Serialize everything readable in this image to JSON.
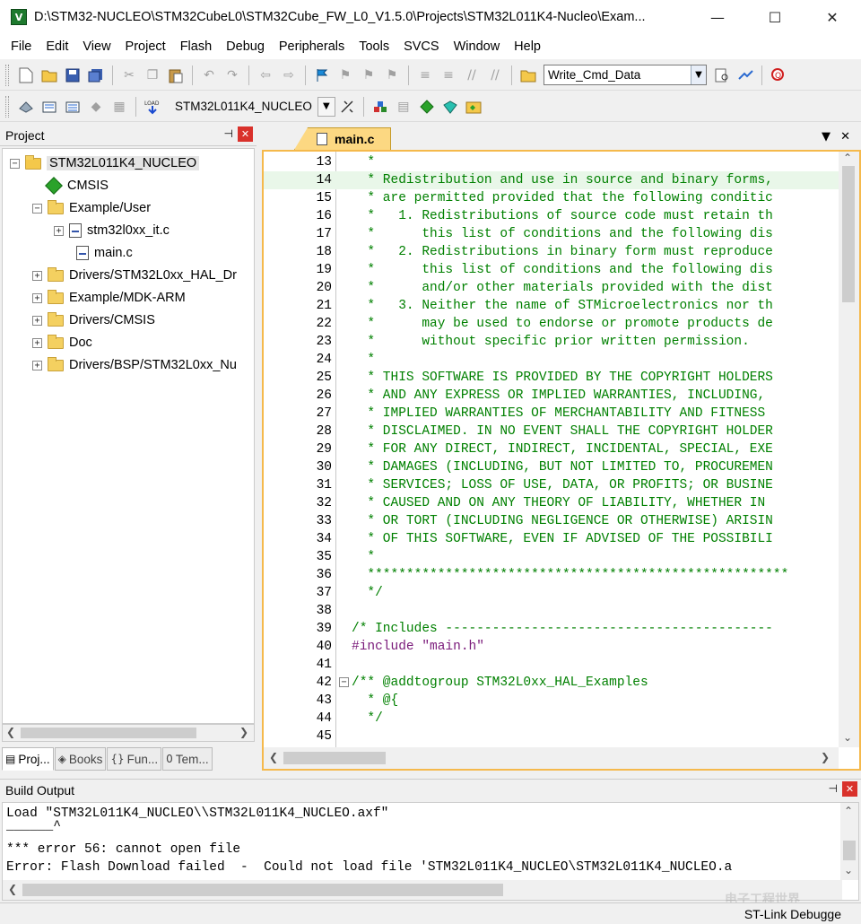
{
  "window": {
    "title": "D:\\STM32-NUCLEO\\STM32CubeL0\\STM32Cube_FW_L0_V1.5.0\\Projects\\STM32L011K4-Nucleo\\Exam...",
    "app_icon": "V",
    "minimize": "—",
    "maximize": "☐",
    "close": "✕"
  },
  "menu": [
    "File",
    "Edit",
    "View",
    "Project",
    "Flash",
    "Debug",
    "Peripherals",
    "Tools",
    "SVCS",
    "Window",
    "Help"
  ],
  "toolbar": {
    "find_combo_value": "Write_Cmd_Data",
    "target_value": "STM32L011K4_NUCLEO"
  },
  "project_panel": {
    "title": "Project",
    "pin": "⊣",
    "close": "✕",
    "tree": [
      {
        "label": "STM32L011K4_NUCLEO",
        "expander": "−",
        "type": "root"
      },
      {
        "label": "CMSIS",
        "expander": "",
        "type": "gem"
      },
      {
        "label": "Example/User",
        "expander": "−",
        "type": "folder"
      },
      {
        "label": "stm32l0xx_it.c",
        "expander": "+",
        "type": "file"
      },
      {
        "label": "main.c",
        "expander": "",
        "type": "file"
      },
      {
        "label": "Drivers/STM32L0xx_HAL_Dr",
        "expander": "+",
        "type": "folder"
      },
      {
        "label": "Example/MDK-ARM",
        "expander": "+",
        "type": "folder"
      },
      {
        "label": "Drivers/CMSIS",
        "expander": "+",
        "type": "folder"
      },
      {
        "label": "Doc",
        "expander": "+",
        "type": "folder"
      },
      {
        "label": "Drivers/BSP/STM32L0xx_Nu",
        "expander": "+",
        "type": "folder"
      }
    ],
    "tabs": [
      "Proj...",
      "Books",
      "Fun...",
      "Tem..."
    ]
  },
  "editor": {
    "tab_label": "main.c",
    "tab_menu": "▼",
    "tab_close": "✕",
    "fold_minus": "−",
    "lines": [
      {
        "n": "13",
        "text": "  *"
      },
      {
        "n": "14",
        "text": "  * Redistribution and use in source and binary forms,"
      },
      {
        "n": "15",
        "text": "  * are permitted provided that the following conditic"
      },
      {
        "n": "16",
        "text": "  *   1. Redistributions of source code must retain th"
      },
      {
        "n": "17",
        "text": "  *      this list of conditions and the following dis"
      },
      {
        "n": "18",
        "text": "  *   2. Redistributions in binary form must reproduce"
      },
      {
        "n": "19",
        "text": "  *      this list of conditions and the following dis"
      },
      {
        "n": "20",
        "text": "  *      and/or other materials provided with the dist"
      },
      {
        "n": "21",
        "text": "  *   3. Neither the name of STMicroelectronics nor th"
      },
      {
        "n": "22",
        "text": "  *      may be used to endorse or promote products de"
      },
      {
        "n": "23",
        "text": "  *      without specific prior written permission."
      },
      {
        "n": "24",
        "text": "  *"
      },
      {
        "n": "25",
        "text": "  * THIS SOFTWARE IS PROVIDED BY THE COPYRIGHT HOLDERS"
      },
      {
        "n": "26",
        "text": "  * AND ANY EXPRESS OR IMPLIED WARRANTIES, INCLUDING,"
      },
      {
        "n": "27",
        "text": "  * IMPLIED WARRANTIES OF MERCHANTABILITY AND FITNESS"
      },
      {
        "n": "28",
        "text": "  * DISCLAIMED. IN NO EVENT SHALL THE COPYRIGHT HOLDER"
      },
      {
        "n": "29",
        "text": "  * FOR ANY DIRECT, INDIRECT, INCIDENTAL, SPECIAL, EXE"
      },
      {
        "n": "30",
        "text": "  * DAMAGES (INCLUDING, BUT NOT LIMITED TO, PROCUREMEN"
      },
      {
        "n": "31",
        "text": "  * SERVICES; LOSS OF USE, DATA, OR PROFITS; OR BUSINE"
      },
      {
        "n": "32",
        "text": "  * CAUSED AND ON ANY THEORY OF LIABILITY, WHETHER IN"
      },
      {
        "n": "33",
        "text": "  * OR TORT (INCLUDING NEGLIGENCE OR OTHERWISE) ARISIN"
      },
      {
        "n": "34",
        "text": "  * OF THIS SOFTWARE, EVEN IF ADVISED OF THE POSSIBILI"
      },
      {
        "n": "35",
        "text": "  *"
      },
      {
        "n": "36",
        "text": "  ******************************************************"
      },
      {
        "n": "37",
        "text": "  */"
      },
      {
        "n": "38",
        "text": ""
      },
      {
        "n": "39",
        "text": "/* Includes ------------------------------------------"
      },
      {
        "n": "40",
        "pre": "#include ",
        "str": "\"main.h\""
      },
      {
        "n": "41",
        "text": ""
      },
      {
        "n": "42",
        "text": "/** @addtogroup STM32L0xx_HAL_Examples"
      },
      {
        "n": "43",
        "text": "  * @{"
      },
      {
        "n": "44",
        "text": "  */"
      },
      {
        "n": "45",
        "text": ""
      }
    ]
  },
  "build_output": {
    "title": "Build Output",
    "pin": "⊣",
    "close": "✕",
    "lines": [
      "Load \"STM32L011K4_NUCLEO\\\\STM32L011K4_NUCLEO.axf\"",
      "______^",
      "*** error 56: cannot open file",
      "Error: Flash Download failed  -  Could not load file 'STM32L011K4_NUCLEO\\STM32L011K4_NUCLEO.a"
    ]
  },
  "status": {
    "debugger": "ST-Link Debugge"
  },
  "watermark": "电子工程世界",
  "colors": {
    "comment": "#008000",
    "preprocessor": "#7a1a7a",
    "editor_border": "#f5b94c",
    "tab_active": "#fcd882",
    "highlight_line": "#e9f7e9"
  }
}
